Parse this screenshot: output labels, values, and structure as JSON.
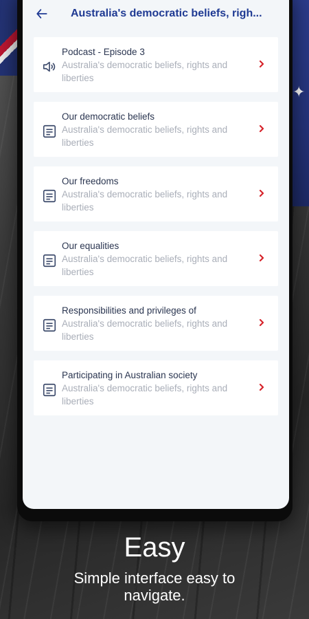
{
  "appbar": {
    "back_icon": "arrow-left-icon",
    "title": "Australia's democratic beliefs, righ..."
  },
  "items": [
    {
      "icon": "speaker-icon",
      "title": "Podcast - Episode 3",
      "subtitle": "Australia's democratic beliefs, rights and liberties"
    },
    {
      "icon": "document-icon",
      "title": "Our democratic beliefs",
      "subtitle": "Australia's democratic beliefs, rights and liberties"
    },
    {
      "icon": "document-icon",
      "title": "Our freedoms",
      "subtitle": "Australia's democratic beliefs, rights and liberties"
    },
    {
      "icon": "document-icon",
      "title": "Our equalities",
      "subtitle": "Australia's democratic beliefs, rights and liberties"
    },
    {
      "icon": "document-icon",
      "title": "Responsibilities and privileges of",
      "subtitle": "Australia's democratic beliefs, rights and liberties"
    },
    {
      "icon": "document-icon",
      "title": "Participating in Australian society",
      "subtitle": "Australia's democratic beliefs, rights and liberties"
    }
  ],
  "caption": {
    "title": "Easy",
    "subtitle": "Simple interface easy to navigate."
  },
  "colors": {
    "accent": "#1f3a93",
    "chevron": "#d6232a",
    "screen_bg": "#f3f6f9"
  }
}
